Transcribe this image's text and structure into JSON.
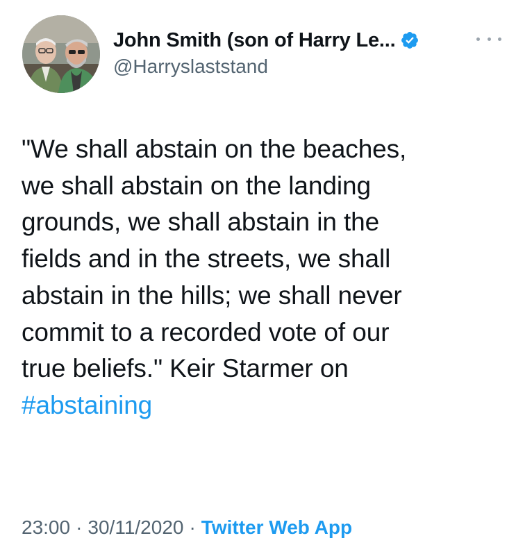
{
  "tweet": {
    "author": {
      "display_name": "John Smith (son of Harry Le...",
      "handle": "@Harryslaststand",
      "verified": true,
      "avatar_icon": "profile-photo"
    },
    "more_icon": "ellipsis-icon",
    "text_main": "\"We shall abstain on the beaches,\nwe shall abstain on the landing\ngrounds, we shall abstain in the\nfields and in the streets, we shall\nabstain in the hills; we shall never\ncommit to a recorded vote of our\ntrue beliefs.\" Keir Starmer on\n",
    "hashtag": "#abstaining",
    "time": "23:00",
    "separator": "·",
    "date": "30/11/2020",
    "source": "Twitter Web App"
  },
  "colors": {
    "text": "#0f1419",
    "secondary": "#536471",
    "accent": "#1d9bf0"
  }
}
